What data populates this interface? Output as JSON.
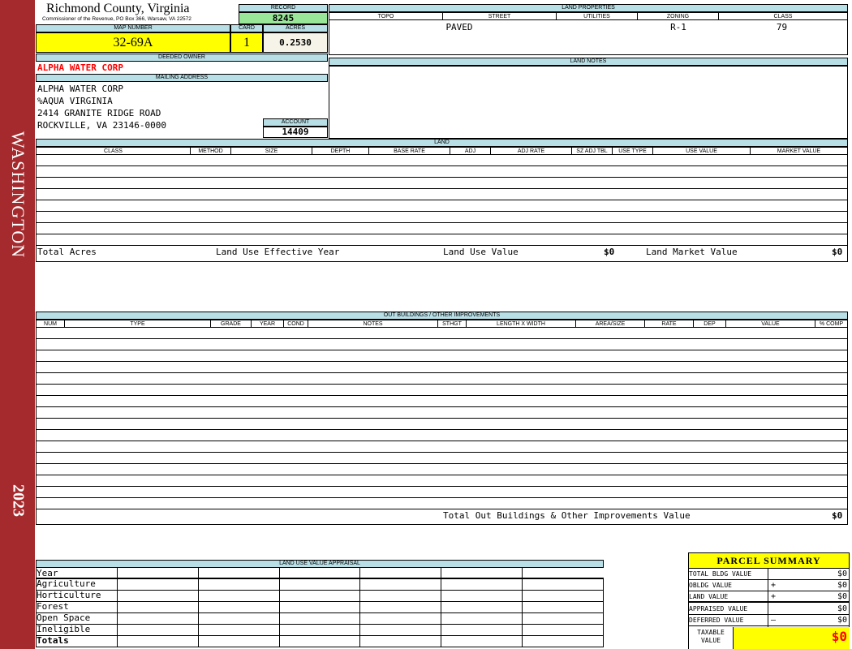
{
  "sidebar": {
    "district": "WASHINGTON",
    "year": "2023"
  },
  "header": {
    "county_title": "Richmond County, Virginia",
    "office_line": "Commissioner of the Revenue, PO Box 366, Warsaw, VA 22572",
    "record_label": "RECORD",
    "record_value": "8245",
    "map_number_label": "MAP NUMBER",
    "map_number": "32-69A",
    "card_label": "CARD",
    "card": "1",
    "acres_label": "ACRES",
    "acres": "0.2530"
  },
  "owner": {
    "deeded_owner_label": "DEEDED OWNER",
    "deeded_owner": "ALPHA WATER CORP",
    "mailing_address_label": "MAILING ADDRESS",
    "address_lines": [
      "ALPHA WATER CORP",
      "%AQUA VIRGINIA",
      "2414 GRANITE RIDGE ROAD",
      "ROCKVILLE, VA 23146-0000"
    ],
    "account_label": "ACCOUNT",
    "account": "14409"
  },
  "land_properties": {
    "title": "LAND PROPERTIES",
    "columns": [
      "TOPO",
      "STREET",
      "UTILITIES",
      "ZONING",
      "CLASS"
    ],
    "values": [
      "",
      "PAVED",
      "",
      "R-1",
      "79"
    ]
  },
  "land_notes": {
    "title": "LAND NOTES"
  },
  "land": {
    "title": "LAND",
    "columns": [
      "CLASS",
      "METHOD",
      "SIZE",
      "DEPTH",
      "BASE RATE",
      "ADJ",
      "ADJ RATE",
      "SZ ADJ TBL",
      "USE TYPE",
      "USE VALUE",
      "MARKET VALUE"
    ],
    "total_acres_label": "Total Acres",
    "effective_year_label": "Land Use Effective Year",
    "use_value_label": "Land Use Value",
    "use_value": "$0",
    "market_value_label": "Land Market Value",
    "market_value": "$0"
  },
  "outbuildings": {
    "title": "OUT BUILDINGS / OTHER IMPROVEMENTS",
    "columns": [
      "NUM",
      "TYPE",
      "GRADE",
      "YEAR",
      "COND",
      "NOTES",
      "STHGT",
      "LENGTH X WIDTH",
      "AREA/SIZE",
      "RATE",
      "DEP",
      "VALUE",
      "% COMP"
    ],
    "total_label": "Total Out Buildings & Other Improvements Value",
    "total_value": "$0"
  },
  "land_use_appraisal": {
    "title": "LAND USE VALUE APPRAISAL",
    "rows": [
      "Year",
      "Agriculture",
      "Horticulture",
      "Forest",
      "Open Space",
      "Ineligible",
      "Totals"
    ]
  },
  "parcel_summary": {
    "title": "PARCEL SUMMARY",
    "rows": [
      {
        "label": "TOTAL BLDG VALUE",
        "sign": "",
        "value": "$0"
      },
      {
        "label": "OBLDG VALUE",
        "sign": "+",
        "value": "$0"
      },
      {
        "label": "LAND VALUE",
        "sign": "+",
        "value": "$0"
      },
      {
        "label": "APPRAISED VALUE",
        "sign": "",
        "value": "$0"
      },
      {
        "label": "DEFERRED VALUE",
        "sign": "–",
        "value": "$0"
      }
    ],
    "taxable_label_1": "TAXABLE",
    "taxable_label_2": "VALUE",
    "taxable_value": "$0"
  },
  "colors": {
    "sidebar": "#a42a2d",
    "header_blue": "#b8dfe6",
    "highlight_yellow": "#ffff00",
    "record_green": "#99e699",
    "owner_red": "#ff0000"
  }
}
